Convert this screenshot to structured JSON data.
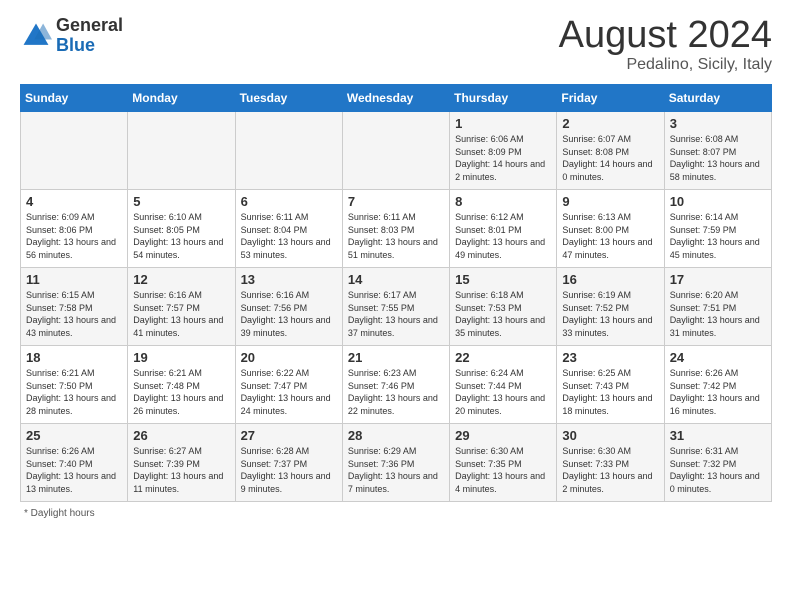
{
  "logo": {
    "general": "General",
    "blue": "Blue"
  },
  "title": "August 2024",
  "location": "Pedalino, Sicily, Italy",
  "days_of_week": [
    "Sunday",
    "Monday",
    "Tuesday",
    "Wednesday",
    "Thursday",
    "Friday",
    "Saturday"
  ],
  "weeks": [
    [
      {
        "day": "",
        "info": ""
      },
      {
        "day": "",
        "info": ""
      },
      {
        "day": "",
        "info": ""
      },
      {
        "day": "",
        "info": ""
      },
      {
        "day": "1",
        "info": "Sunrise: 6:06 AM\nSunset: 8:09 PM\nDaylight: 14 hours\nand 2 minutes."
      },
      {
        "day": "2",
        "info": "Sunrise: 6:07 AM\nSunset: 8:08 PM\nDaylight: 14 hours\nand 0 minutes."
      },
      {
        "day": "3",
        "info": "Sunrise: 6:08 AM\nSunset: 8:07 PM\nDaylight: 13 hours\nand 58 minutes."
      }
    ],
    [
      {
        "day": "4",
        "info": "Sunrise: 6:09 AM\nSunset: 8:06 PM\nDaylight: 13 hours\nand 56 minutes."
      },
      {
        "day": "5",
        "info": "Sunrise: 6:10 AM\nSunset: 8:05 PM\nDaylight: 13 hours\nand 54 minutes."
      },
      {
        "day": "6",
        "info": "Sunrise: 6:11 AM\nSunset: 8:04 PM\nDaylight: 13 hours\nand 53 minutes."
      },
      {
        "day": "7",
        "info": "Sunrise: 6:11 AM\nSunset: 8:03 PM\nDaylight: 13 hours\nand 51 minutes."
      },
      {
        "day": "8",
        "info": "Sunrise: 6:12 AM\nSunset: 8:01 PM\nDaylight: 13 hours\nand 49 minutes."
      },
      {
        "day": "9",
        "info": "Sunrise: 6:13 AM\nSunset: 8:00 PM\nDaylight: 13 hours\nand 47 minutes."
      },
      {
        "day": "10",
        "info": "Sunrise: 6:14 AM\nSunset: 7:59 PM\nDaylight: 13 hours\nand 45 minutes."
      }
    ],
    [
      {
        "day": "11",
        "info": "Sunrise: 6:15 AM\nSunset: 7:58 PM\nDaylight: 13 hours\nand 43 minutes."
      },
      {
        "day": "12",
        "info": "Sunrise: 6:16 AM\nSunset: 7:57 PM\nDaylight: 13 hours\nand 41 minutes."
      },
      {
        "day": "13",
        "info": "Sunrise: 6:16 AM\nSunset: 7:56 PM\nDaylight: 13 hours\nand 39 minutes."
      },
      {
        "day": "14",
        "info": "Sunrise: 6:17 AM\nSunset: 7:55 PM\nDaylight: 13 hours\nand 37 minutes."
      },
      {
        "day": "15",
        "info": "Sunrise: 6:18 AM\nSunset: 7:53 PM\nDaylight: 13 hours\nand 35 minutes."
      },
      {
        "day": "16",
        "info": "Sunrise: 6:19 AM\nSunset: 7:52 PM\nDaylight: 13 hours\nand 33 minutes."
      },
      {
        "day": "17",
        "info": "Sunrise: 6:20 AM\nSunset: 7:51 PM\nDaylight: 13 hours\nand 31 minutes."
      }
    ],
    [
      {
        "day": "18",
        "info": "Sunrise: 6:21 AM\nSunset: 7:50 PM\nDaylight: 13 hours\nand 28 minutes."
      },
      {
        "day": "19",
        "info": "Sunrise: 6:21 AM\nSunset: 7:48 PM\nDaylight: 13 hours\nand 26 minutes."
      },
      {
        "day": "20",
        "info": "Sunrise: 6:22 AM\nSunset: 7:47 PM\nDaylight: 13 hours\nand 24 minutes."
      },
      {
        "day": "21",
        "info": "Sunrise: 6:23 AM\nSunset: 7:46 PM\nDaylight: 13 hours\nand 22 minutes."
      },
      {
        "day": "22",
        "info": "Sunrise: 6:24 AM\nSunset: 7:44 PM\nDaylight: 13 hours\nand 20 minutes."
      },
      {
        "day": "23",
        "info": "Sunrise: 6:25 AM\nSunset: 7:43 PM\nDaylight: 13 hours\nand 18 minutes."
      },
      {
        "day": "24",
        "info": "Sunrise: 6:26 AM\nSunset: 7:42 PM\nDaylight: 13 hours\nand 16 minutes."
      }
    ],
    [
      {
        "day": "25",
        "info": "Sunrise: 6:26 AM\nSunset: 7:40 PM\nDaylight: 13 hours\nand 13 minutes."
      },
      {
        "day": "26",
        "info": "Sunrise: 6:27 AM\nSunset: 7:39 PM\nDaylight: 13 hours\nand 11 minutes."
      },
      {
        "day": "27",
        "info": "Sunrise: 6:28 AM\nSunset: 7:37 PM\nDaylight: 13 hours\nand 9 minutes."
      },
      {
        "day": "28",
        "info": "Sunrise: 6:29 AM\nSunset: 7:36 PM\nDaylight: 13 hours\nand 7 minutes."
      },
      {
        "day": "29",
        "info": "Sunrise: 6:30 AM\nSunset: 7:35 PM\nDaylight: 13 hours\nand 4 minutes."
      },
      {
        "day": "30",
        "info": "Sunrise: 6:30 AM\nSunset: 7:33 PM\nDaylight: 13 hours\nand 2 minutes."
      },
      {
        "day": "31",
        "info": "Sunrise: 6:31 AM\nSunset: 7:32 PM\nDaylight: 13 hours\nand 0 minutes."
      }
    ]
  ],
  "footer": "Daylight hours"
}
